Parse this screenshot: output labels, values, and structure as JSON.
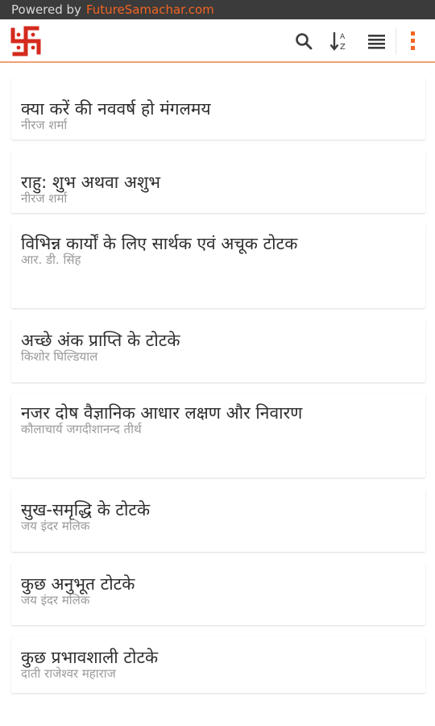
{
  "powered_bar": {
    "prefix": "Powered by",
    "brand": "FutureSamachar.com"
  },
  "header": {
    "logo_icon": "swastika-icon",
    "actions": [
      "search-icon",
      "sort-az-icon",
      "list-view-icon",
      "overflow-menu-icon"
    ],
    "accent_color": "#f26522"
  },
  "articles": [
    {
      "title": "क्या करें की नववर्ष हो मंगलमय",
      "author": "नीरज शर्मा"
    },
    {
      "title": "राहु: शुभ अथवा अशुभ",
      "author": "नीरज शर्मा"
    },
    {
      "title": "विभिन्न कार्यों के लिए सार्थक एवं अचूक टोटक",
      "author": "आर. डी. सिंह"
    },
    {
      "title": "अच्छे अंक प्राप्ति के टोटके",
      "author": "किशोर घिल्डियाल"
    },
    {
      "title": "नजर दोष वैज्ञानिक आधार लक्षण और निवारण",
      "author": "कौलाचार्य जगदीशानन्द तीर्थ"
    },
    {
      "title": "सुख-समृद्धि के टोटके",
      "author": "जय इंदर मलिक"
    },
    {
      "title": "कुछ अनुभूत टोटके",
      "author": "जय इंदर मलिक"
    },
    {
      "title": "कुछ प्रभावशाली टोटके",
      "author": "दाती राजेश्वर महाराज"
    }
  ]
}
